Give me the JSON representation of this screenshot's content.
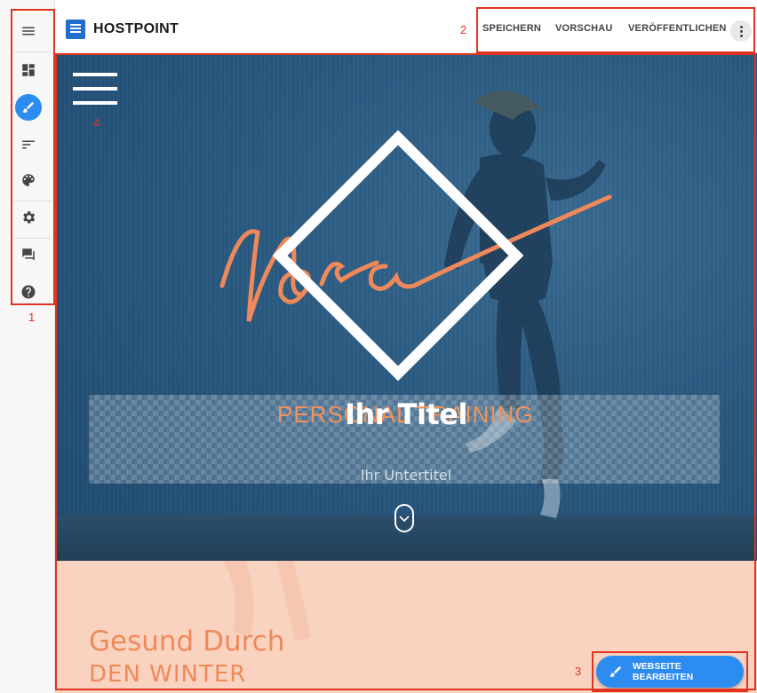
{
  "brand": {
    "name": "HOSTPOINT",
    "logo": "hostpoint-logo"
  },
  "sidebar": {
    "items": [
      {
        "icon": "menu-icon"
      },
      {
        "icon": "dashboard-icon"
      },
      {
        "icon": "brush-icon",
        "active": true
      },
      {
        "icon": "sort-icon"
      },
      {
        "icon": "palette-icon"
      },
      {
        "icon": "gear-icon"
      },
      {
        "icon": "chat-icon"
      },
      {
        "icon": "help-icon"
      }
    ]
  },
  "toolbar": {
    "save_label": "SPEICHERN",
    "preview_label": "VORSCHAU",
    "publish_label": "VERÖFFENTLICHEN",
    "more_icon": "more-vertical-icon"
  },
  "hero": {
    "script_name": "Nora",
    "personal_training": "PERSONAL TRAINING",
    "title": "Ihr Titel",
    "subtitle": "Ihr Untertitel"
  },
  "section": {
    "title_line1": "Gesund Durch",
    "title_line2": "DEN WINTER"
  },
  "edit_button": {
    "label": "WEBSEITE BEARBEITEN"
  },
  "annotations": {
    "n1": "1",
    "n2": "2",
    "n3": "3",
    "n4": "4"
  },
  "colors": {
    "accent": "#2d8cf0",
    "orange": "#f0895a",
    "hero_blue": "#2b5b83",
    "peach": "#f9d3c0",
    "annotation_red": "#e23320"
  }
}
